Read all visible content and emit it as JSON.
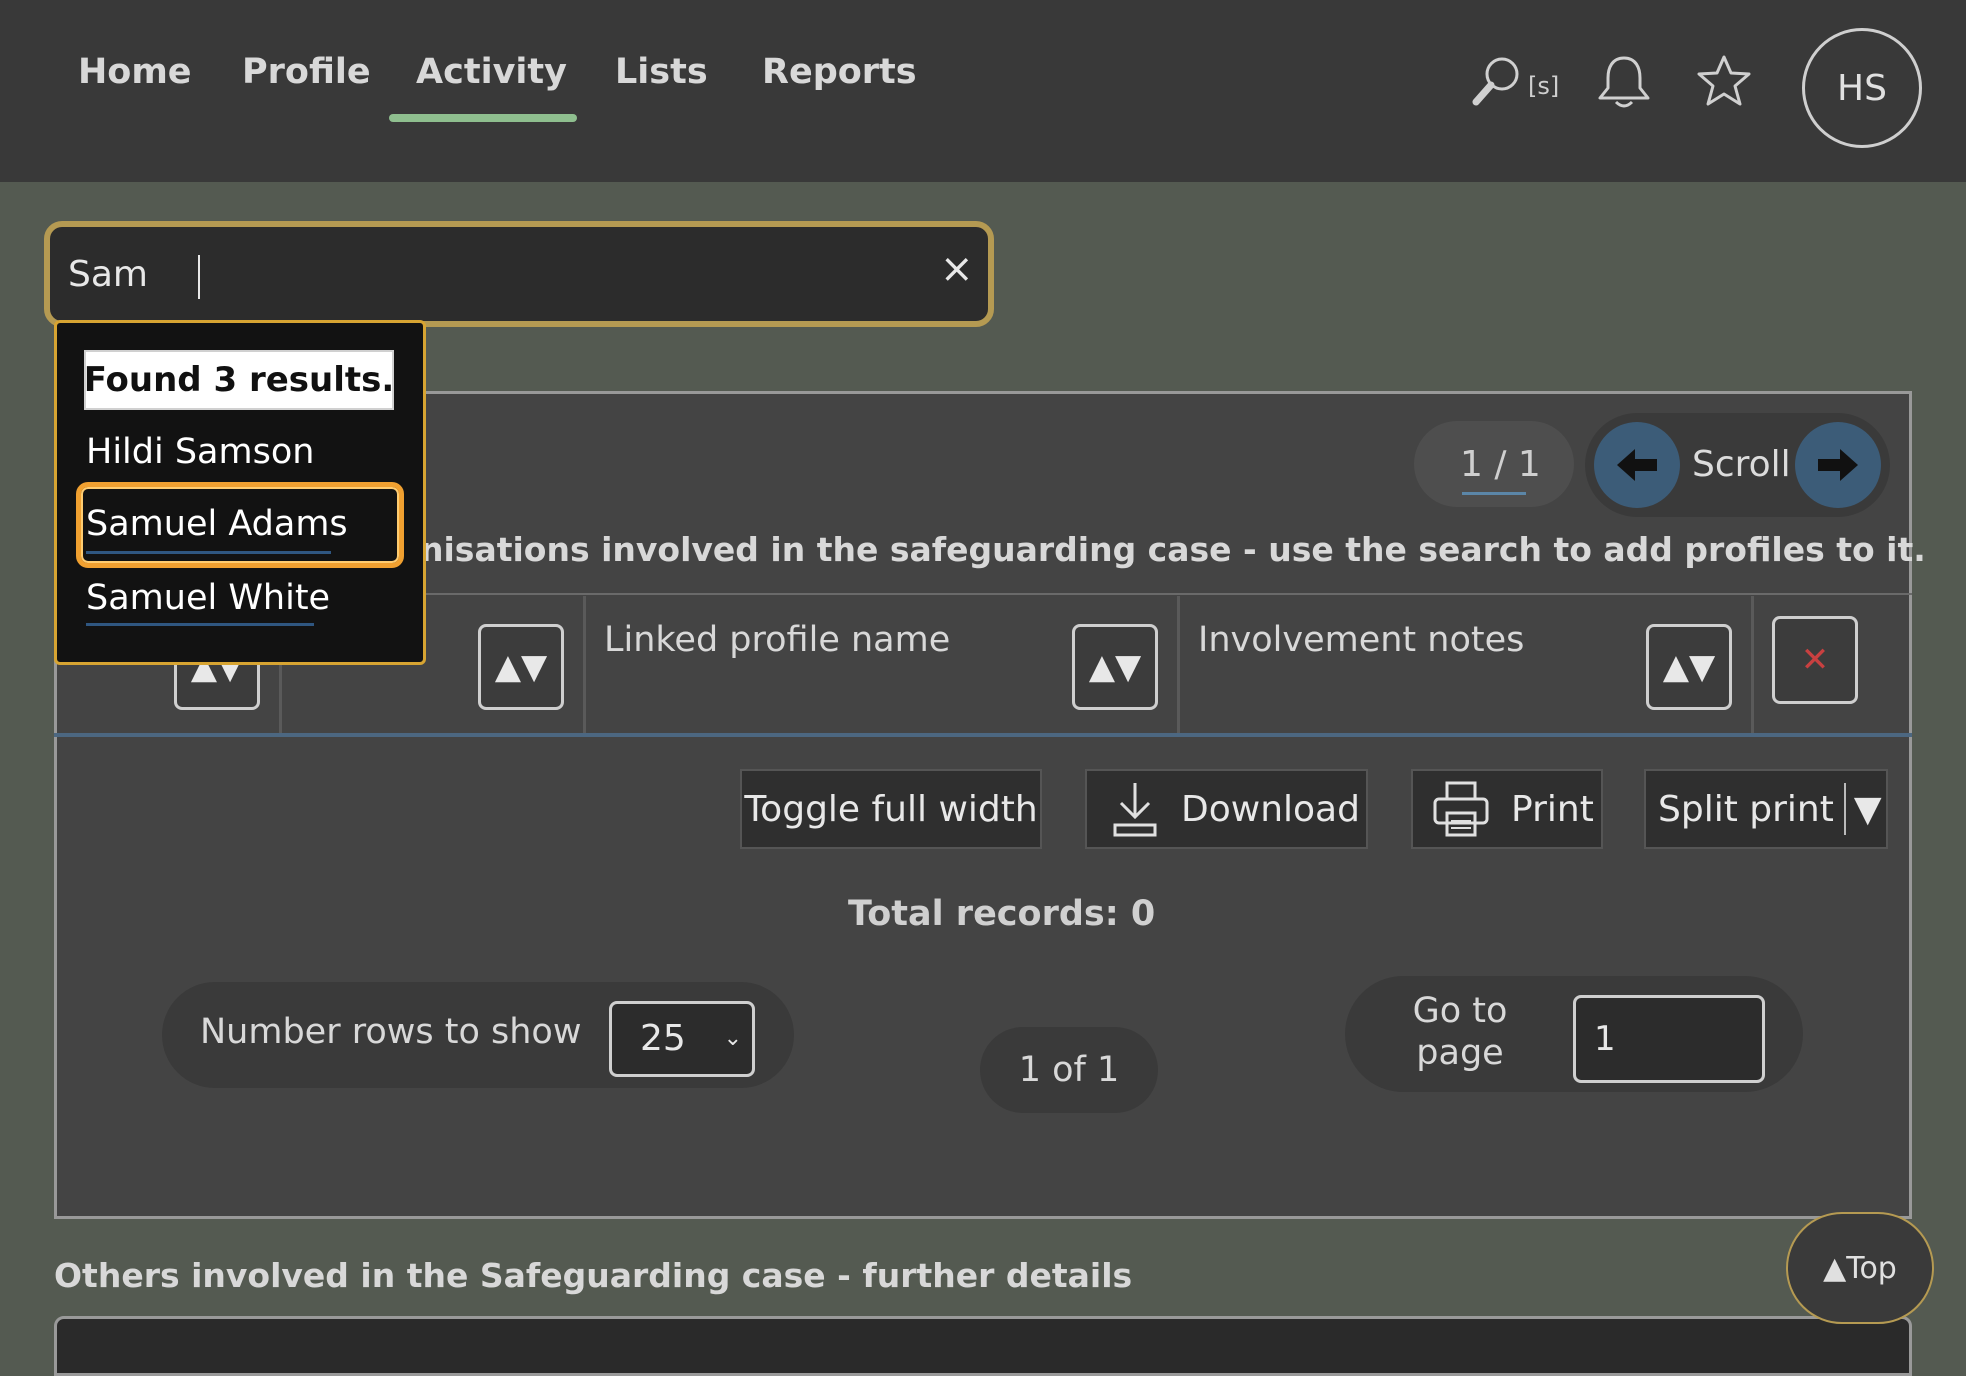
{
  "nav": {
    "items": [
      {
        "label": "Home"
      },
      {
        "label": "Profile"
      },
      {
        "label": "Activity",
        "active": true
      },
      {
        "label": "Lists"
      },
      {
        "label": "Reports"
      }
    ],
    "search_shortcut": "[s]",
    "avatar_initials": "HS",
    "active_color": "#8fbf8f"
  },
  "search": {
    "value": "Sam",
    "clear_label": "×"
  },
  "autocomplete": {
    "status": "Found 3 results.",
    "results": [
      {
        "label": "Hildi Samson"
      },
      {
        "label": "Samuel Adams",
        "highlighted": true
      },
      {
        "label": "Samuel White"
      }
    ],
    "highlight_color": "#f0a030"
  },
  "panel": {
    "pager": "1 / 1",
    "scroll_label": "Scroll",
    "description": "nisations involved in the safeguarding case - use the search to add profiles to it.",
    "columns": [
      {
        "label": ""
      },
      {
        "label": ""
      },
      {
        "label": "Linked profile name"
      },
      {
        "label": "Involvement notes"
      }
    ],
    "sort_glyph": "▲▼",
    "delete_glyph": "✕",
    "actions": {
      "toggle": "Toggle full width",
      "download": "Download",
      "print": "Print",
      "split_print": "Split print",
      "split_caret": "▼"
    },
    "total_records": "Total records: 0",
    "rows_label": "Number rows to show",
    "rows_value": "25",
    "page_of": "1 of 1",
    "goto_label": "Go to page",
    "goto_value": "1"
  },
  "others": {
    "label": "Others involved in the Safeguarding case - further details"
  },
  "top_button": "▲Top"
}
